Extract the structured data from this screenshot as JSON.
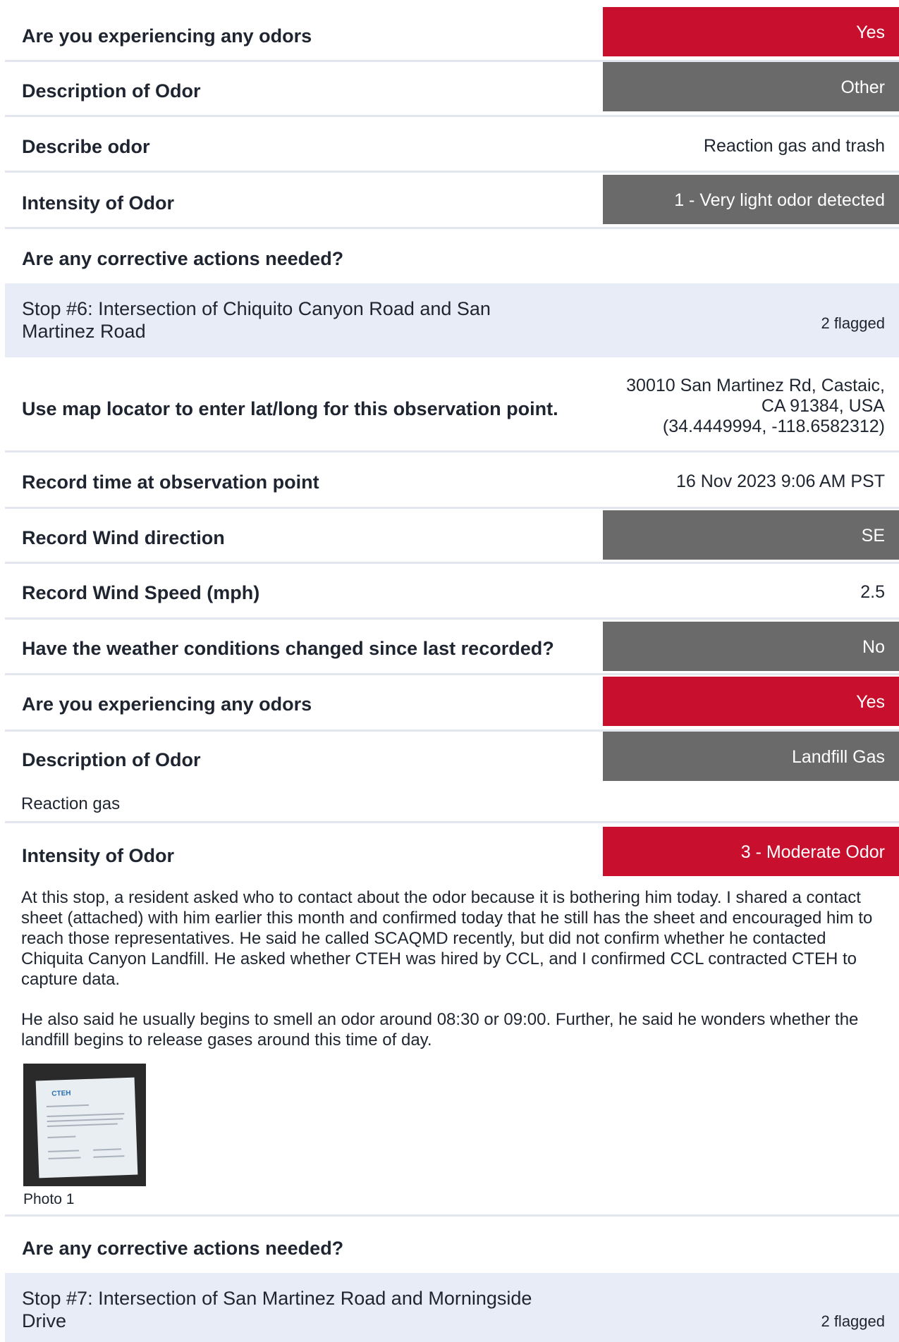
{
  "rows": {
    "odors_1": {
      "question": "Are you experiencing any odors",
      "answer": "Yes"
    },
    "desc_1": {
      "question": "Description of Odor",
      "answer": "Other"
    },
    "describe_1": {
      "question": "Describe odor",
      "answer": "Reaction gas and trash"
    },
    "intensity_1": {
      "question": "Intensity of Odor",
      "answer": "1 - Very light odor detected"
    },
    "corrective_1": {
      "question": "Are any corrective actions needed?"
    },
    "stop6": {
      "title": "Stop #6: Intersection of Chiquito Canyon Road and San Martinez Road",
      "flagged": "2 flagged"
    },
    "location": {
      "question": "Use map locator to enter lat/long for this observation point.",
      "line1": "30010 San Martinez Rd, Castaic,",
      "line2": "CA 91384, USA",
      "line3": "(34.4449994, -118.6582312)"
    },
    "time": {
      "question": "Record time at observation point",
      "answer": "16 Nov 2023 9:06 AM PST"
    },
    "wind_dir": {
      "question": "Record Wind direction",
      "answer": "SE"
    },
    "wind_speed": {
      "question": "Record Wind Speed (mph)",
      "answer": "2.5"
    },
    "weather": {
      "question": "Have the weather conditions changed since last recorded?",
      "answer": "No"
    },
    "odors_2": {
      "question": "Are you experiencing any odors",
      "answer": "Yes"
    },
    "desc_2": {
      "question": "Description of Odor",
      "answer": "Landfill Gas",
      "note": "Reaction gas"
    },
    "intensity_2": {
      "question": "Intensity of Odor",
      "answer": "3 - Moderate Odor"
    },
    "corrective_2": {
      "question": "Are any corrective actions needed?"
    },
    "stop7": {
      "title": "Stop #7: Intersection of San Martinez Road and Morningside Drive",
      "flagged": "2 flagged"
    }
  },
  "notes": {
    "p1": "At this stop, a resident asked who to contact about the odor because it is bothering him today. I shared a contact sheet (attached) with him earlier this month and confirmed today that he still has the sheet and encouraged him to reach those representatives. He said he called SCAQMD recently, but did not confirm whether he contacted Chiquita Canyon Landfill. He asked whether CTEH was hired by CCL, and I confirmed CCL contracted CTEH to capture data.",
    "p2": "He also said he usually begins to smell an odor around 08:30 or 09:00. Further, he said he wonders whether the landfill begins to release gases around this time of day."
  },
  "photo": {
    "logo": "CTEH",
    "caption": "Photo 1"
  },
  "colors": {
    "red": "#c8102e",
    "grey": "#6a6a6a",
    "stop_bg": "#e8ecf6"
  }
}
